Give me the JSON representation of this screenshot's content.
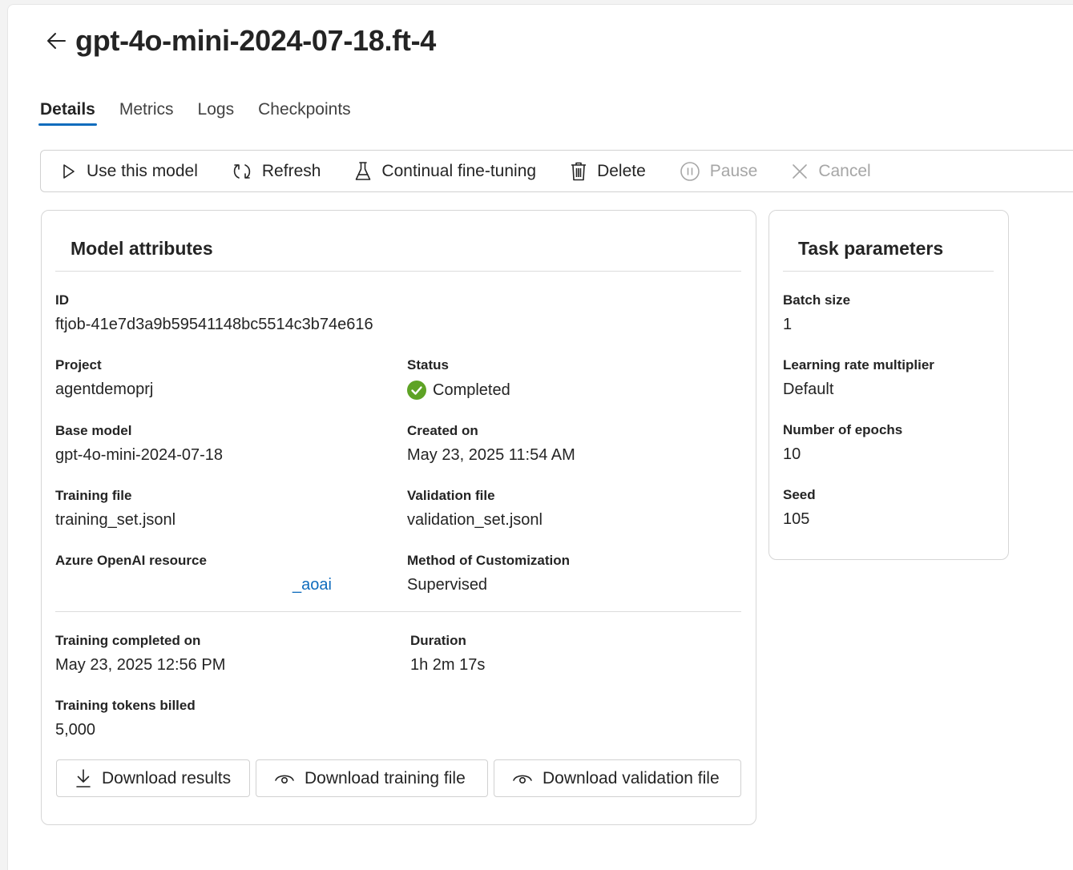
{
  "header": {
    "title": "gpt-4o-mini-2024-07-18.ft-4"
  },
  "tabs": [
    {
      "label": "Details",
      "active": true
    },
    {
      "label": "Metrics",
      "active": false
    },
    {
      "label": "Logs",
      "active": false
    },
    {
      "label": "Checkpoints",
      "active": false
    }
  ],
  "toolbar": {
    "use_model": "Use this model",
    "refresh": "Refresh",
    "continual": "Continual fine-tuning",
    "delete": "Delete",
    "pause": "Pause",
    "cancel": "Cancel"
  },
  "model_attributes": {
    "title": "Model attributes",
    "id": {
      "label": "ID",
      "value": "ftjob-41e7d3a9b59541148bc5514c3b74e616"
    },
    "project": {
      "label": "Project",
      "value": "agentdemoprj"
    },
    "status": {
      "label": "Status",
      "value": "Completed",
      "color": "#5ea325"
    },
    "base_model": {
      "label": "Base model",
      "value": "gpt-4o-mini-2024-07-18"
    },
    "created_on": {
      "label": "Created on",
      "value": "May 23, 2025 11:54 AM"
    },
    "training_file": {
      "label": "Training file",
      "value": "training_set.jsonl"
    },
    "validation_file": {
      "label": "Validation file",
      "value": "validation_set.jsonl"
    },
    "resource": {
      "label": "Azure OpenAI resource",
      "value": "_aoai"
    },
    "method": {
      "label": "Method of Customization",
      "value": "Supervised"
    },
    "training_completed": {
      "label": "Training completed on",
      "value": "May 23, 2025 12:56 PM"
    },
    "duration": {
      "label": "Duration",
      "value": "1h 2m 17s"
    },
    "tokens_billed": {
      "label": "Training tokens billed",
      "value": "5,000"
    },
    "buttons": {
      "download_results": "Download results",
      "download_training": "Download training file",
      "download_validation": "Download validation file"
    }
  },
  "task_parameters": {
    "title": "Task parameters",
    "batch_size": {
      "label": "Batch size",
      "value": "1"
    },
    "lr_multiplier": {
      "label": "Learning rate multiplier",
      "value": "Default"
    },
    "epochs": {
      "label": "Number of epochs",
      "value": "10"
    },
    "seed": {
      "label": "Seed",
      "value": "105"
    }
  },
  "colors": {
    "accent": "#0f6cbd",
    "success": "#5ea325"
  }
}
